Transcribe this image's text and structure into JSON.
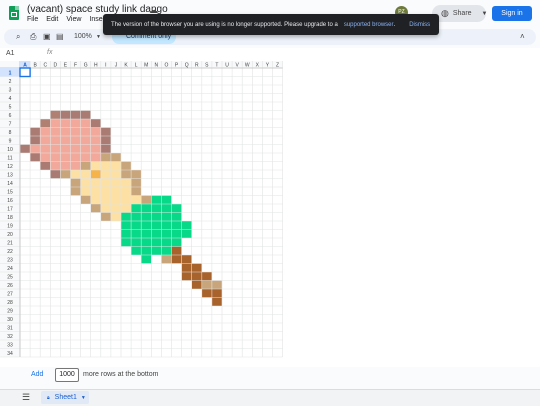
{
  "doc": {
    "title": "(vacant) space study link dango"
  },
  "menu": [
    "File",
    "Edit",
    "View",
    "Insert"
  ],
  "banner": {
    "message": "The version of the browser you are using is no longer supported. Please upgrade to a",
    "link": "supported browser",
    "period": ".",
    "dismiss": "Dismiss"
  },
  "header": {
    "avatar": "PZ",
    "share": "Share",
    "signin": "Sign in"
  },
  "toolbar": {
    "zoom": "100%",
    "mode": "Comment only"
  },
  "formula_bar": {
    "cell_ref": "A1",
    "fx": "fx"
  },
  "grid": {
    "columns": [
      "A",
      "B",
      "C",
      "D",
      "E",
      "F",
      "G",
      "H",
      "I",
      "J",
      "K",
      "L",
      "M",
      "N",
      "O",
      "P",
      "Q",
      "R",
      "S",
      "T",
      "U",
      "V",
      "W",
      "X",
      "Y",
      "Z"
    ],
    "row_count": 34,
    "selected": "A1",
    "pixel_art": [
      {
        "row": 6,
        "cells": [
          [
            3,
            3,
            "c1"
          ],
          [
            4,
            6,
            "c2"
          ]
        ]
      },
      {
        "row": 7,
        "cells": [
          [
            2,
            2,
            "c1"
          ],
          [
            3,
            6,
            "c3"
          ],
          [
            7,
            7,
            "c2"
          ]
        ]
      },
      {
        "row": 8,
        "cells": [
          [
            1,
            1,
            "c2"
          ],
          [
            2,
            7,
            "c3"
          ],
          [
            8,
            8,
            "c2"
          ]
        ]
      },
      {
        "row": 9,
        "cells": [
          [
            1,
            1,
            "c2"
          ],
          [
            2,
            7,
            "c3"
          ],
          [
            8,
            8,
            "c2"
          ]
        ]
      },
      {
        "row": 10,
        "cells": [
          [
            0,
            0,
            "c2"
          ],
          [
            1,
            7,
            "c3"
          ],
          [
            8,
            8,
            "c2"
          ]
        ]
      },
      {
        "row": 11,
        "cells": [
          [
            1,
            1,
            "c2"
          ],
          [
            2,
            7,
            "c3"
          ],
          [
            8,
            9,
            "c4"
          ]
        ]
      },
      {
        "row": 12,
        "cells": [
          [
            2,
            2,
            "c2"
          ],
          [
            3,
            5,
            "c3"
          ],
          [
            6,
            6,
            "c4"
          ],
          [
            7,
            9,
            "c5"
          ],
          [
            10,
            10,
            "c4"
          ]
        ]
      },
      {
        "row": 13,
        "cells": [
          [
            3,
            3,
            "c2"
          ],
          [
            4,
            4,
            "c4"
          ],
          [
            5,
            6,
            "c5"
          ],
          [
            7,
            7,
            "c7"
          ],
          [
            8,
            9,
            "c5"
          ],
          [
            10,
            11,
            "c4"
          ]
        ]
      },
      {
        "row": 14,
        "cells": [
          [
            5,
            5,
            "c4"
          ],
          [
            6,
            10,
            "c5"
          ],
          [
            11,
            11,
            "c4"
          ]
        ]
      },
      {
        "row": 15,
        "cells": [
          [
            5,
            5,
            "c4"
          ],
          [
            6,
            10,
            "c5"
          ],
          [
            11,
            11,
            "c4"
          ]
        ]
      },
      {
        "row": 16,
        "cells": [
          [
            6,
            6,
            "c4"
          ],
          [
            7,
            11,
            "c5"
          ],
          [
            12,
            12,
            "c4"
          ],
          [
            13,
            14,
            "c6"
          ]
        ]
      },
      {
        "row": 17,
        "cells": [
          [
            7,
            7,
            "c4"
          ],
          [
            8,
            10,
            "c5"
          ],
          [
            11,
            15,
            "c6"
          ]
        ]
      },
      {
        "row": 18,
        "cells": [
          [
            8,
            8,
            "c4"
          ],
          [
            9,
            9,
            "c5"
          ],
          [
            10,
            15,
            "c6"
          ]
        ]
      },
      {
        "row": 19,
        "cells": [
          [
            10,
            15,
            "c6"
          ],
          [
            16,
            16,
            "c6"
          ]
        ]
      },
      {
        "row": 20,
        "cells": [
          [
            10,
            15,
            "c6"
          ],
          [
            16,
            16,
            "c6"
          ]
        ]
      },
      {
        "row": 21,
        "cells": [
          [
            10,
            15,
            "c6"
          ]
        ]
      },
      {
        "row": 22,
        "cells": [
          [
            11,
            11,
            "c6"
          ],
          [
            12,
            14,
            "c6"
          ],
          [
            15,
            15,
            "c8"
          ]
        ]
      },
      {
        "row": 23,
        "cells": [
          [
            12,
            12,
            "c6"
          ],
          [
            14,
            14,
            "c4"
          ],
          [
            15,
            15,
            "c8"
          ],
          [
            16,
            16,
            "c8"
          ]
        ]
      },
      {
        "row": 24,
        "cells": [
          [
            16,
            16,
            "c8"
          ],
          [
            17,
            17,
            "c8"
          ]
        ]
      },
      {
        "row": 25,
        "cells": [
          [
            16,
            16,
            "c8"
          ],
          [
            17,
            18,
            "c8"
          ]
        ]
      },
      {
        "row": 26,
        "cells": [
          [
            17,
            17,
            "c8"
          ],
          [
            18,
            18,
            "c4"
          ],
          [
            19,
            19,
            "c4"
          ]
        ]
      },
      {
        "row": 27,
        "cells": [
          [
            18,
            19,
            "c8"
          ]
        ]
      },
      {
        "row": 28,
        "cells": [
          [
            19,
            19,
            "c8"
          ]
        ]
      }
    ],
    "palette": {
      "c1": "#b08173",
      "c2": "#a97b72",
      "c3": "#f2a99b",
      "c4": "#c8a57a",
      "c5": "#fde0a4",
      "c6": "#08d989",
      "c7": "#f5b34a",
      "c8": "#a8632c"
    }
  },
  "add_rows": {
    "link": "Add",
    "count": "1000",
    "suffix": "more rows at the bottom"
  },
  "sheet": {
    "name": "Sheet1"
  }
}
